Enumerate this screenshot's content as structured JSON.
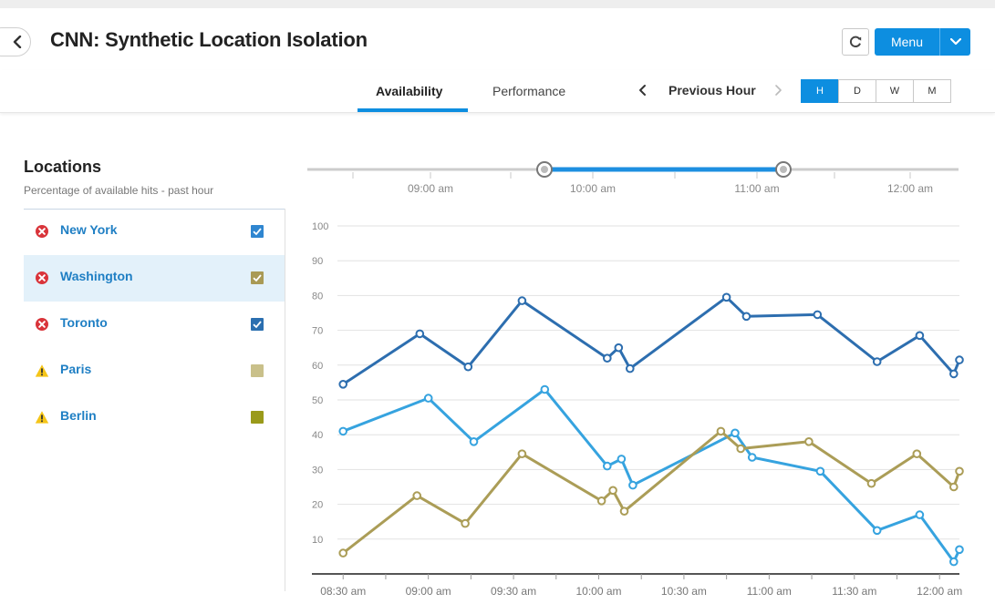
{
  "header": {
    "title": "CNN: Synthetic Location Isolation",
    "menu_label": "Menu"
  },
  "toolbar": {
    "tabs": [
      {
        "label": "Availability",
        "active": true
      },
      {
        "label": "Performance",
        "active": false
      }
    ],
    "period_label": "Previous Hour",
    "ranges": [
      {
        "label": "H",
        "active": true
      },
      {
        "label": "D",
        "active": false
      },
      {
        "label": "W",
        "active": false
      },
      {
        "label": "M",
        "active": false
      }
    ]
  },
  "locations": {
    "title": "Locations",
    "subtitle": "Percentage of available hits - past hour",
    "items": [
      {
        "name": "New York",
        "status": "error",
        "checked": true,
        "color": "#2b6fb0",
        "selected": false
      },
      {
        "name": "Washington",
        "status": "error",
        "checked": true,
        "color": "#a99a55",
        "selected": true
      },
      {
        "name": "Toronto",
        "status": "error",
        "checked": true,
        "color": "#2b6fb0",
        "selected": false
      },
      {
        "name": "Paris",
        "status": "warning",
        "checked": false,
        "color": "#c9c08a",
        "selected": false
      },
      {
        "name": "Berlin",
        "status": "warning",
        "checked": false,
        "color": "#9a9a1a",
        "selected": false
      }
    ]
  },
  "colors": {
    "accent": "#0d8ee0",
    "error": "#d9343a",
    "warning": "#f5c518"
  },
  "time_slider": {
    "tick_labels": [
      "09:00 am",
      "10:00 am",
      "11:00 am",
      "12:00 am"
    ],
    "range_start": "09:40 am",
    "range_end": "11:13 am"
  },
  "chart_data": {
    "type": "line",
    "ylim": [
      0,
      100
    ],
    "yticks": [
      10,
      20,
      30,
      40,
      50,
      60,
      70,
      80,
      90,
      100
    ],
    "xlim": [
      "08:28 am",
      "12:07 am"
    ],
    "xtick_labels": [
      "08:30 am",
      "09:00 am",
      "09:30 am",
      "10:00 am",
      "10:30 am",
      "11:00 am",
      "11:30 am",
      "12:00 am"
    ],
    "grid": true,
    "series": [
      {
        "color": "#2d6eaf",
        "points": [
          [
            "08:30",
            54.5
          ],
          [
            "08:57",
            69
          ],
          [
            "09:14",
            59.5
          ],
          [
            "09:33",
            78.5
          ],
          [
            "10:03",
            62
          ],
          [
            "10:07",
            65
          ],
          [
            "10:11",
            59
          ],
          [
            "10:45",
            79.5
          ],
          [
            "10:52",
            74
          ],
          [
            "11:17",
            74.5
          ],
          [
            "11:38",
            61
          ],
          [
            "11:53",
            68.5
          ],
          [
            "12:05",
            57.5
          ],
          [
            "12:07",
            61.5
          ]
        ]
      },
      {
        "color": "#36a3df",
        "points": [
          [
            "08:30",
            41
          ],
          [
            "09:00",
            50.5
          ],
          [
            "09:16",
            38
          ],
          [
            "09:41",
            53
          ],
          [
            "10:03",
            31
          ],
          [
            "10:08",
            33
          ],
          [
            "10:12",
            25.5
          ],
          [
            "10:48",
            40.5
          ],
          [
            "10:54",
            33.5
          ],
          [
            "11:18",
            29.5
          ],
          [
            "11:38",
            12.5
          ],
          [
            "11:53",
            17
          ],
          [
            "12:05",
            3.5
          ],
          [
            "12:07",
            7
          ]
        ]
      },
      {
        "color": "#ab9d57",
        "points": [
          [
            "08:30",
            6
          ],
          [
            "08:56",
            22.5
          ],
          [
            "09:13",
            14.5
          ],
          [
            "09:33",
            34.5
          ],
          [
            "10:01",
            21
          ],
          [
            "10:05",
            24
          ],
          [
            "10:09",
            18
          ],
          [
            "10:43",
            41
          ],
          [
            "10:50",
            36
          ],
          [
            "11:14",
            38
          ],
          [
            "11:36",
            26
          ],
          [
            "11:52",
            34.5
          ],
          [
            "12:05",
            25
          ],
          [
            "12:07",
            29.5
          ]
        ]
      }
    ]
  }
}
